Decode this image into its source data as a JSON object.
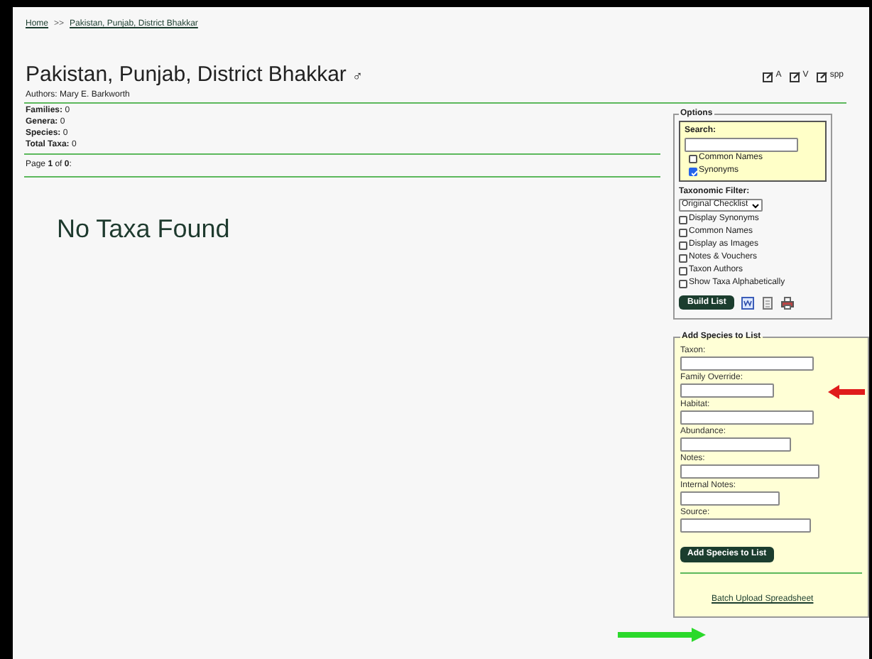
{
  "breadcrumb": [
    {
      "label": "Home"
    },
    {
      "label": ">>",
      "kind": "separator"
    },
    {
      "label": "Pakistan, Punjab, District Bhakkar"
    }
  ],
  "title": "Pakistan, Punjab, District Bhakkar",
  "title_symbol": "♂",
  "authors": "Authors: Mary E. Barkworth",
  "edit_links": [
    {
      "label": "A"
    },
    {
      "label": "V"
    },
    {
      "label": "spp"
    }
  ],
  "stats": [
    {
      "label": "Families:",
      "value": "0"
    },
    {
      "label": "Genera:",
      "value": "0"
    },
    {
      "label": "Species:",
      "value": "0"
    },
    {
      "label": "Total Taxa:",
      "value": "0"
    }
  ],
  "paging": {
    "prefix": "Page ",
    "page": "1",
    "middle": " of ",
    "total": "0",
    "suffix": ":"
  },
  "message": "No Taxa Found",
  "options": {
    "legend": "Options",
    "search_label": "Search:",
    "search_checks": [
      {
        "label": "Common Names",
        "checked": false
      },
      {
        "label": "Synonyms",
        "checked": true
      }
    ],
    "filter_label": "Taxonomic Filter:",
    "filter_value": "Original Checklist",
    "checks": [
      {
        "label": "Display Synonyms",
        "checked": false
      },
      {
        "label": "Common Names",
        "checked": false
      },
      {
        "label": "Display as Images",
        "checked": false
      },
      {
        "label": "Notes & Vouchers",
        "checked": false
      },
      {
        "label": "Taxon Authors",
        "checked": false
      },
      {
        "label": "Show Taxa Alphabetically",
        "checked": false
      }
    ],
    "build_button": "Build List"
  },
  "add_species": {
    "legend": "Add Species to List",
    "fields": [
      {
        "label": "Taxon:"
      },
      {
        "label": "Family Override:"
      },
      {
        "label": "Habitat:"
      },
      {
        "label": "Abundance:"
      },
      {
        "label": "Notes:"
      },
      {
        "label": "Internal Notes:"
      },
      {
        "label": "Source:"
      }
    ],
    "button": "Add Species to List",
    "batch_link": "Batch Upload Spreadsheet"
  }
}
